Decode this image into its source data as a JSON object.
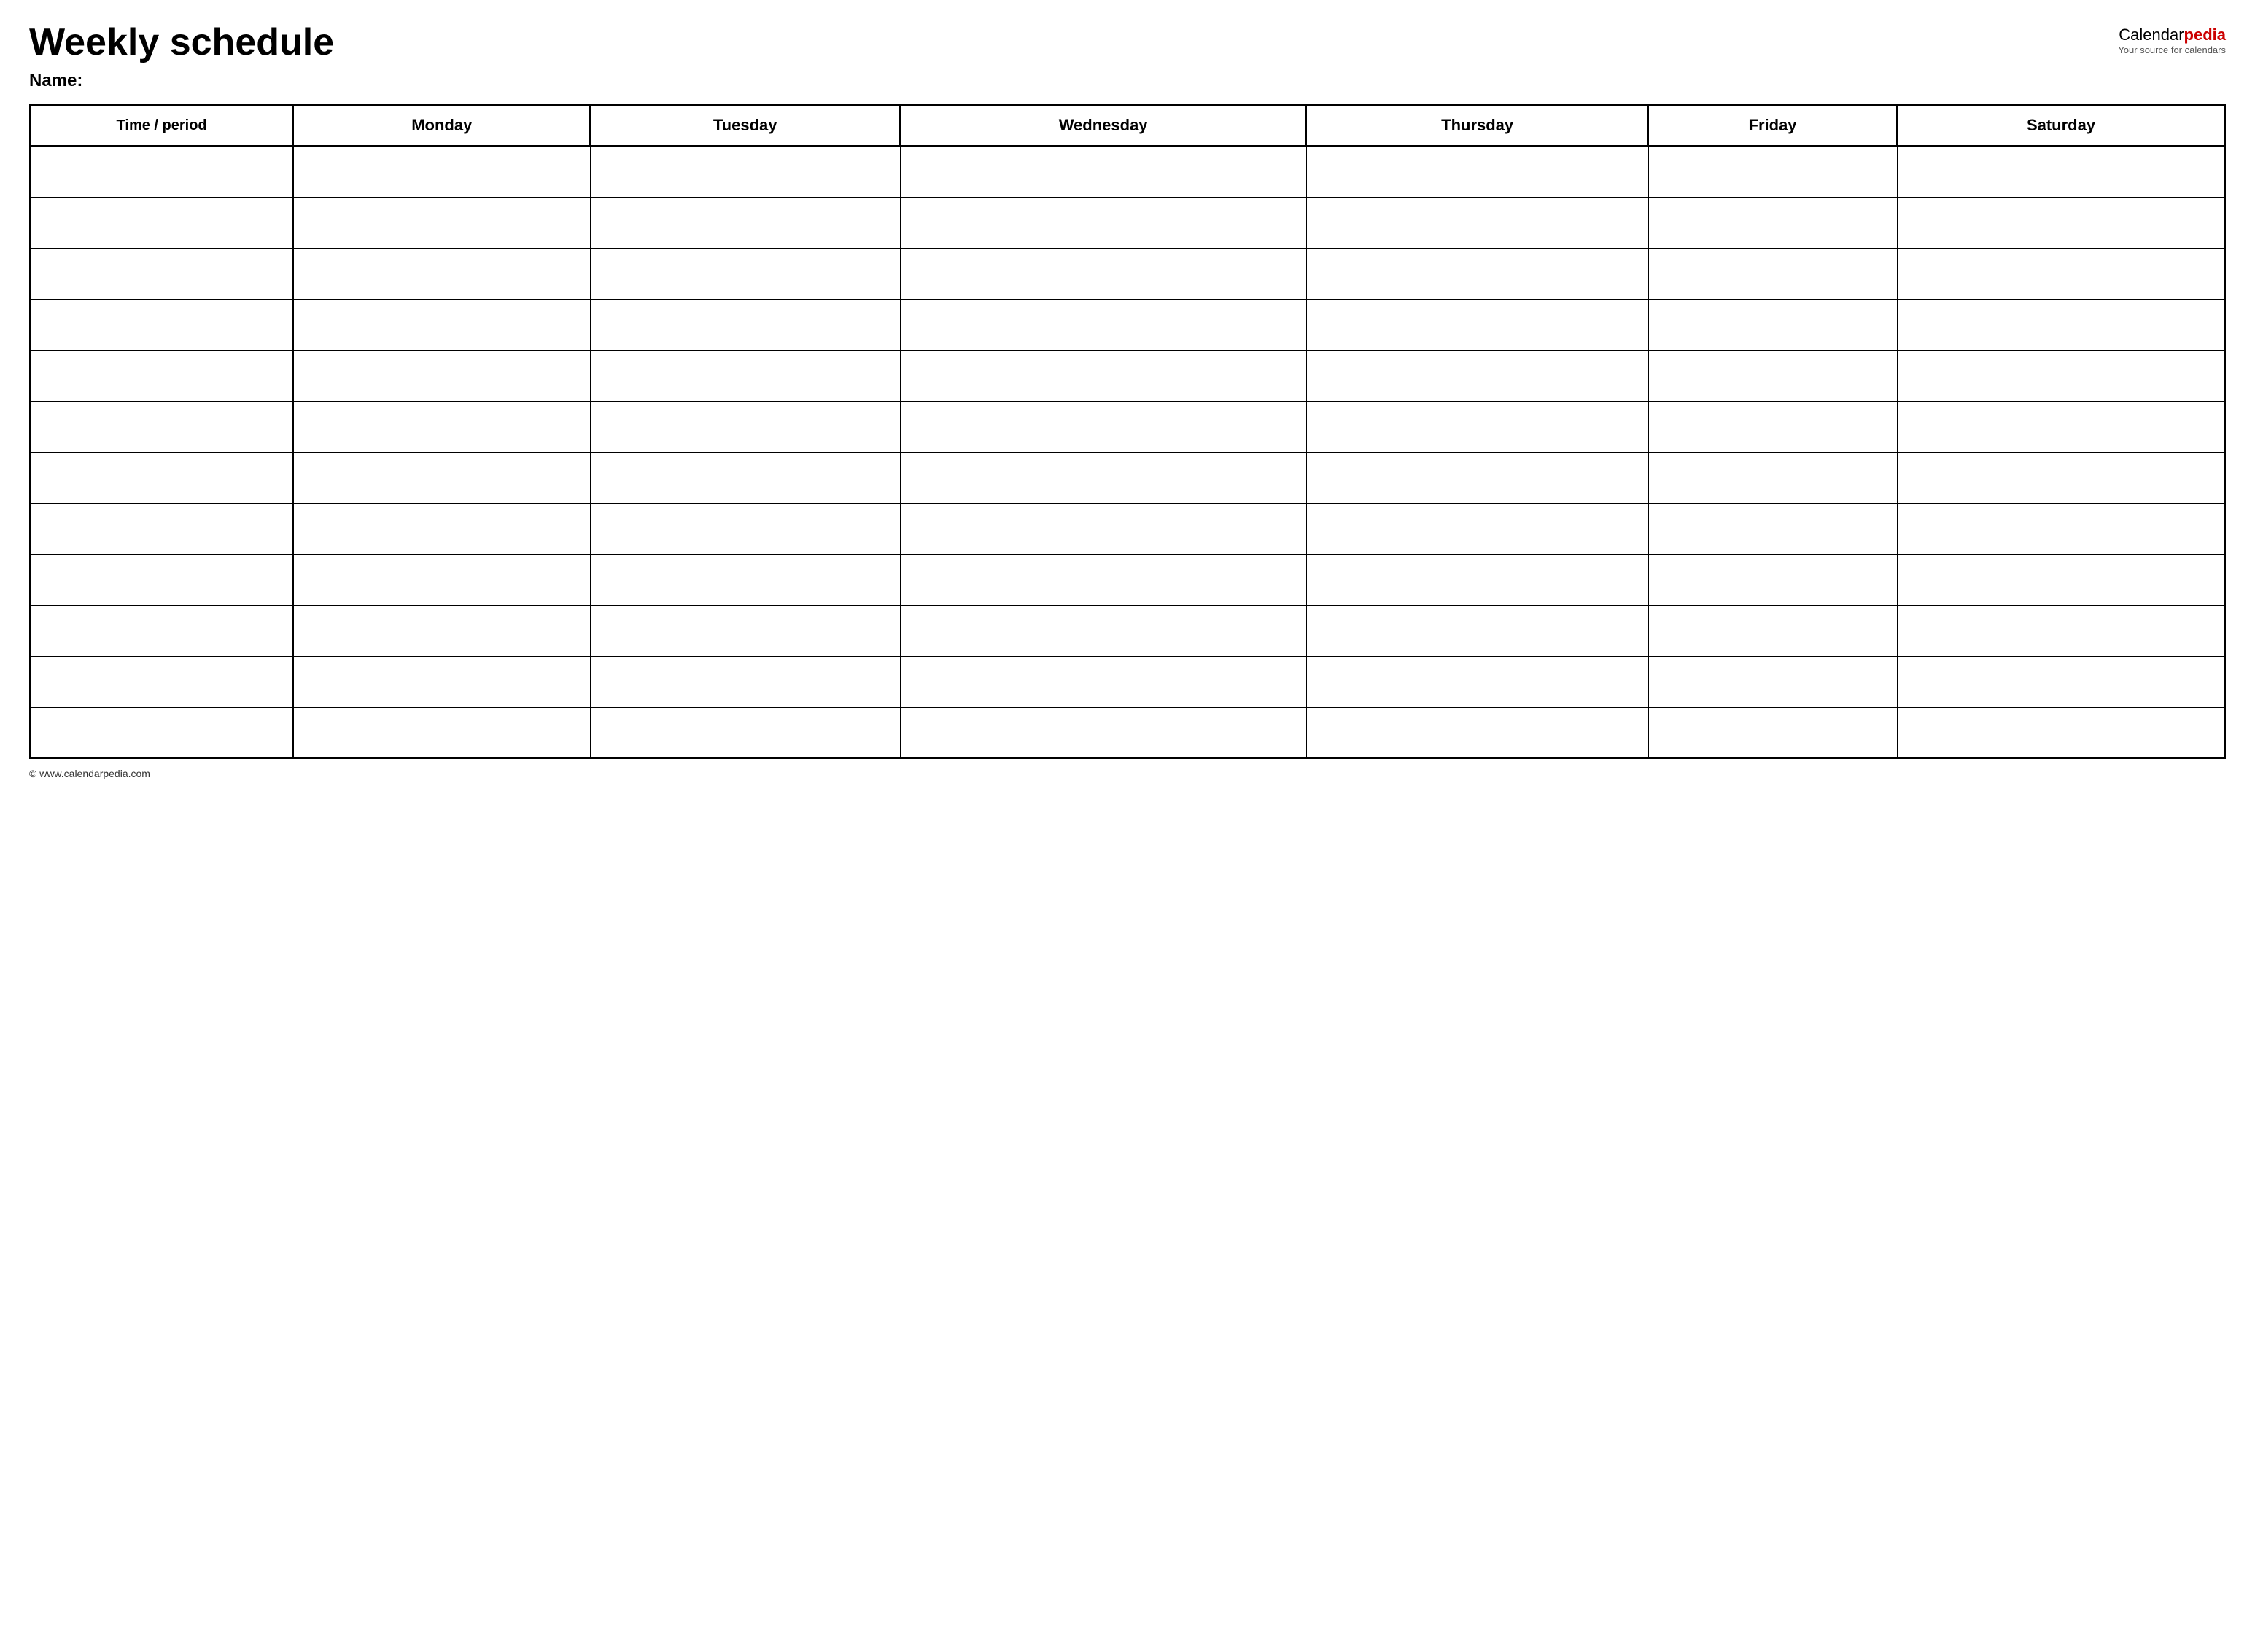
{
  "header": {
    "title": "Weekly schedule",
    "logo_calendar": "Calendar",
    "logo_pedia": "pedia",
    "logo_subtitle": "Your source for calendars"
  },
  "name_label": "Name:",
  "footer_text": "© www.calendarpedia.com",
  "table": {
    "columns": [
      "Time / period",
      "Monday",
      "Tuesday",
      "Wednesday",
      "Thursday",
      "Friday",
      "Saturday"
    ],
    "row_count": 12
  }
}
